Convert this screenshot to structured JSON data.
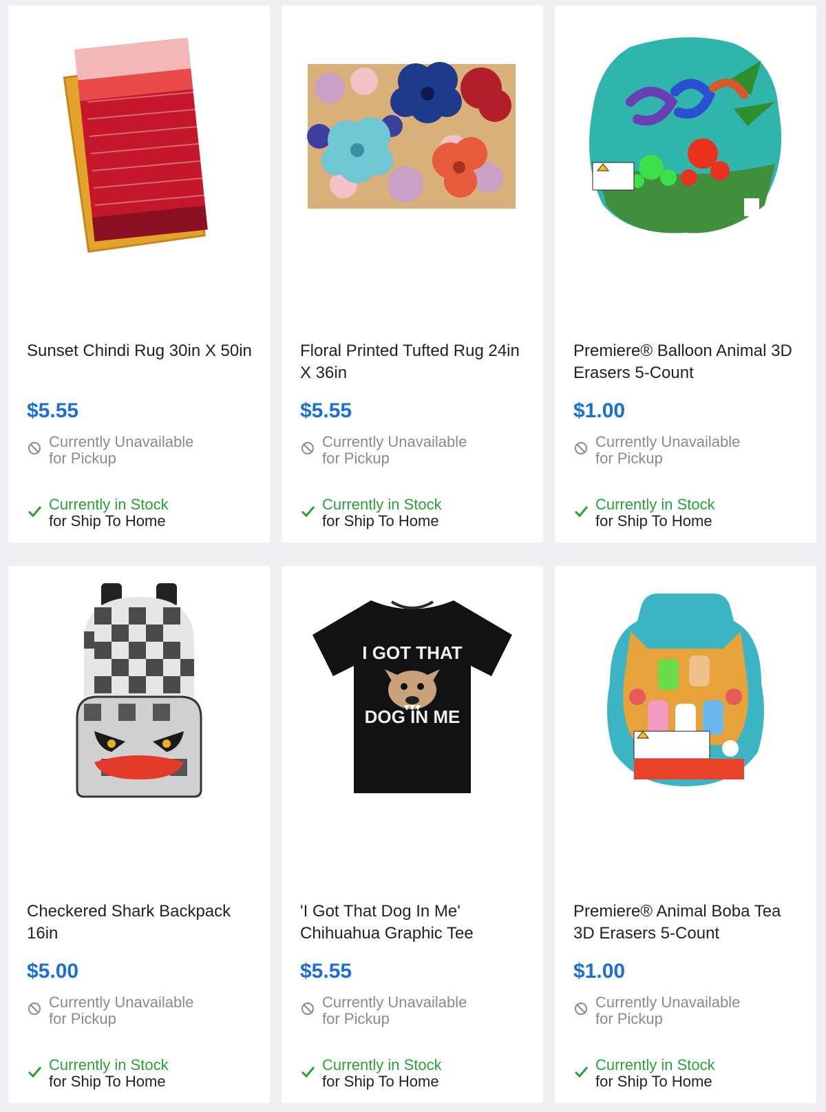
{
  "colors": {
    "price": "#1a6fd4",
    "in_stock": "#2aa03a",
    "unavailable": "#8a8a8a",
    "background": "#efeff2",
    "card": "#ffffff"
  },
  "products": [
    {
      "image": "sunset-chindi-rug-image",
      "title": "Sunset Chindi Rug 30in X 50in",
      "price": "$5.55",
      "pickup_line1": "Currently Unavailable",
      "pickup_line2": "for Pickup",
      "ship_line1": "Currently in Stock",
      "ship_line2": "for Ship To Home"
    },
    {
      "image": "floral-tufted-rug-image",
      "title": "Floral Printed Tufted Rug 24in X 36in",
      "price": "$5.55",
      "pickup_line1": "Currently Unavailable",
      "pickup_line2": "for Pickup",
      "ship_line1": "Currently in Stock",
      "ship_line2": "for Ship To Home"
    },
    {
      "image": "balloon-animal-erasers-image",
      "title": "Premiere® Balloon Animal 3D Erasers 5-Count",
      "price": "$1.00",
      "pickup_line1": "Currently Unavailable",
      "pickup_line2": "for Pickup",
      "ship_line1": "Currently in Stock",
      "ship_line2": "for Ship To Home"
    },
    {
      "image": "checkered-shark-backpack-image",
      "title": "Checkered Shark Backpack 16in",
      "price": "$5.00",
      "pickup_line1": "Currently Unavailable",
      "pickup_line2": "for Pickup",
      "ship_line1": "Currently in Stock",
      "ship_line2": "for Ship To Home"
    },
    {
      "image": "chihuahua-graphic-tee-image",
      "title": "'I Got That Dog In Me' Chihuahua Graphic Tee",
      "price": "$5.55",
      "pickup_line1": "Currently Unavailable",
      "pickup_line2": "for Pickup",
      "ship_line1": "Currently in Stock",
      "ship_line2": "for Ship To Home",
      "shirt_text_top": "I GOT THAT",
      "shirt_text_bottom": "DOG IN ME"
    },
    {
      "image": "boba-tea-erasers-image",
      "title": "Premiere® Animal Boba Tea 3D Erasers 5-Count",
      "price": "$1.00",
      "pickup_line1": "Currently Unavailable",
      "pickup_line2": "for Pickup",
      "ship_line1": "Currently in Stock",
      "ship_line2": "for Ship To Home"
    }
  ]
}
